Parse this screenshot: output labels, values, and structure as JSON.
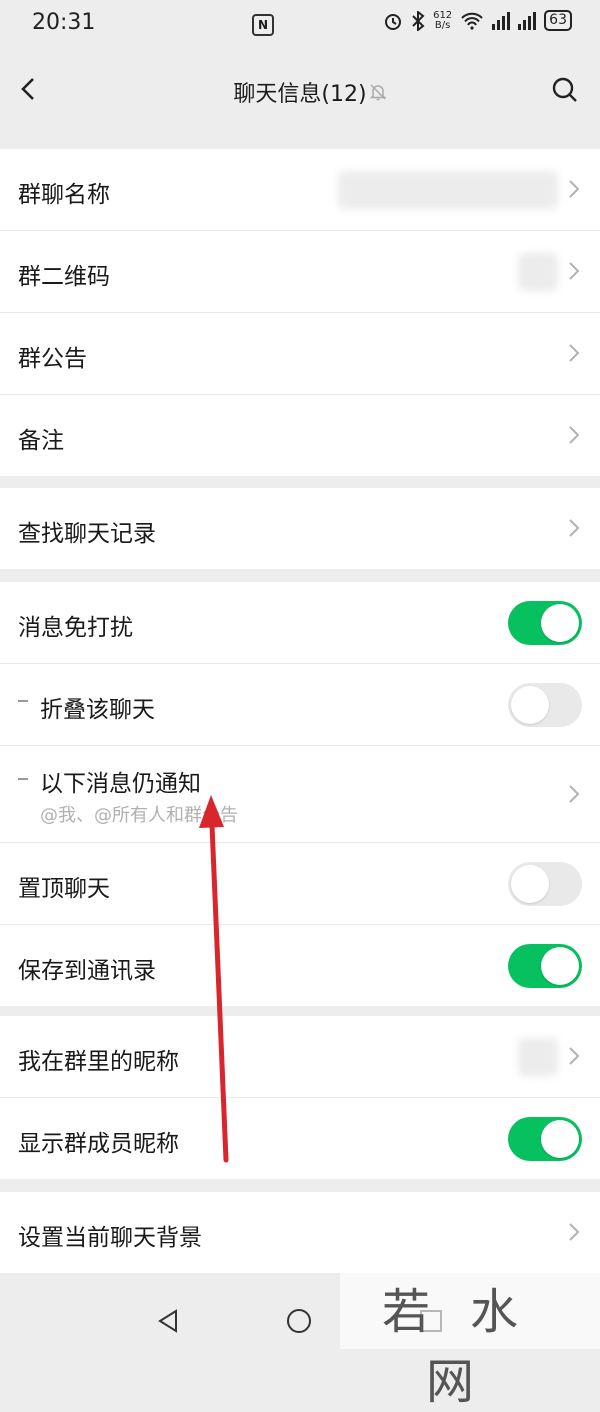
{
  "status_bar": {
    "time": "20:31",
    "nfc": "N",
    "speed_value": "612",
    "speed_unit": "B/s",
    "battery": "63"
  },
  "header": {
    "title": "聊天信息(12)",
    "back_icon": "chevron-left-icon",
    "mute_icon": "bell-off-icon",
    "search_icon": "search-icon"
  },
  "group1": {
    "items": [
      {
        "label": "群聊名称"
      },
      {
        "label": "群二维码"
      },
      {
        "label": "群公告"
      },
      {
        "label": "备注"
      }
    ]
  },
  "group2": {
    "items": [
      {
        "label": "查找聊天记录"
      }
    ]
  },
  "group3": {
    "do_not_disturb": {
      "label": "消息免打扰",
      "on": true
    },
    "fold_chat": {
      "label": "折叠该聊天",
      "on": false
    },
    "notify_exceptions": {
      "label": "以下消息仍通知",
      "sublabel": "@我、@所有人和群公告"
    },
    "pin_chat": {
      "label": "置顶聊天",
      "on": false
    },
    "save_contacts": {
      "label": "保存到通讯录",
      "on": true
    }
  },
  "group4": {
    "my_nickname": {
      "label": "我在群里的昵称"
    },
    "show_member_nicknames": {
      "label": "显示群成员昵称",
      "on": true
    }
  },
  "group5": {
    "items": [
      {
        "label": "设置当前聊天背景"
      }
    ]
  },
  "watermark": {
    "text": "若水网"
  },
  "colors": {
    "accent": "#07c160",
    "annotation_arrow": "#d9252c",
    "background": "#ededed"
  }
}
